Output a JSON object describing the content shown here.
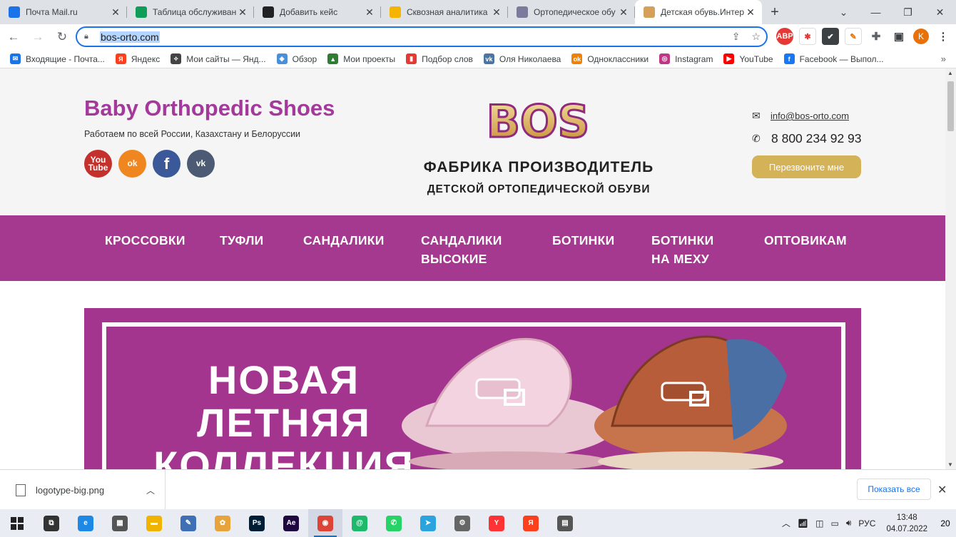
{
  "browser": {
    "tabs": [
      {
        "title": "Почта Mail.ru",
        "icon": "mail-icon",
        "color": "#1a73e8"
      },
      {
        "title": "Таблица обслуживания",
        "icon": "sheets-icon",
        "color": "#0f9d58"
      },
      {
        "title": "Добавить кейс",
        "icon": "star-badge-icon",
        "color": "#202124"
      },
      {
        "title": "Сквозная аналитика",
        "icon": "analytics-icon",
        "color": "#f4b400"
      },
      {
        "title": "Ортопедическое обу",
        "icon": "site-icon",
        "color": "#7b7b9b"
      },
      {
        "title": "Детская обувь.Интер",
        "icon": "bos-favicon-icon",
        "color": "#d4a05a",
        "active": true
      }
    ],
    "new_tab": "+",
    "url": "bos-orto.com",
    "profile_letter": "K"
  },
  "bookmarks": [
    {
      "label": "Входящие - Почта...",
      "color": "#1a73e8",
      "glyph": "✉"
    },
    {
      "label": "Яндекс",
      "color": "#fc3f1d",
      "glyph": "Я"
    },
    {
      "label": "Мои сайты — Янд...",
      "color": "#444",
      "glyph": "⟡"
    },
    {
      "label": "Обзор",
      "color": "#4a90d9",
      "glyph": "◈"
    },
    {
      "label": "Мои проекты",
      "color": "#2e7d32",
      "glyph": "▲"
    },
    {
      "label": "Подбор слов",
      "color": "#e53935",
      "glyph": "▮"
    },
    {
      "label": "Оля Николаева",
      "color": "#4c75a3",
      "glyph": "vk"
    },
    {
      "label": "Одноклассники",
      "color": "#ee8208",
      "glyph": "ok"
    },
    {
      "label": "Instagram",
      "color": "#c13584",
      "glyph": "◎"
    },
    {
      "label": "YouTube",
      "color": "#ff0000",
      "glyph": "▶"
    },
    {
      "label": "Facebook — Выпол...",
      "color": "#1877f2",
      "glyph": "f"
    }
  ],
  "site": {
    "brand": "Baby Orthopedic Shoes",
    "tagline": "Работаем по всей России, Казахстану и Белоруссии",
    "logo_text": "BOS",
    "factory_line1": "ФАБРИКА ПРОИЗВОДИТЕЛЬ",
    "factory_line2": "ДЕТСКОЙ ОРТОПЕДИЧЕСКОЙ ОБУВИ",
    "email": "info@bos-orto.com",
    "phone": "8 800 234 92 93",
    "callback": "Перезвоните мне",
    "socials": [
      {
        "name": "youtube",
        "glyph": "You\nTube",
        "color": "#c4302b"
      },
      {
        "name": "odnoklassniki",
        "glyph": "ok",
        "color": "#f0861f"
      },
      {
        "name": "facebook",
        "glyph": "f",
        "color": "#3b5998"
      },
      {
        "name": "vk",
        "glyph": "vk",
        "color": "#4c5a73"
      }
    ],
    "menu": [
      {
        "label": "КРОССОВКИ"
      },
      {
        "label": "ТУФЛИ"
      },
      {
        "label": "САНДАЛИКИ"
      },
      {
        "label": "САНДАЛИКИ\nВЫСОКИЕ"
      },
      {
        "label": "БОТИНКИ"
      },
      {
        "label": "БОТИНКИ\nНА МЕХУ"
      },
      {
        "label": "ОПТОВИКАМ"
      }
    ],
    "banner_lines": [
      "НОВАЯ",
      "ЛЕТНЯЯ",
      "КОЛЛЕКЦИЯ"
    ],
    "colors": {
      "brand": "#a2399b",
      "menu": "#a5388f",
      "gold": "#d4b257"
    }
  },
  "downloads": {
    "file": "logotype-big.png",
    "show_all": "Показать все"
  },
  "taskbar": {
    "apps": [
      {
        "name": "task-view",
        "color": "#333",
        "glyph": "⧉"
      },
      {
        "name": "edge",
        "color": "#1e88e5",
        "glyph": "e"
      },
      {
        "name": "calculator",
        "color": "#555",
        "glyph": "▦"
      },
      {
        "name": "explorer",
        "color": "#f0b400",
        "glyph": "▬"
      },
      {
        "name": "notes",
        "color": "#3f6fb5",
        "glyph": "✎"
      },
      {
        "name": "paint",
        "color": "#e8a43a",
        "glyph": "✿"
      },
      {
        "name": "photoshop",
        "color": "#001e36",
        "glyph": "Ps"
      },
      {
        "name": "after-effects",
        "color": "#1f0740",
        "glyph": "Ae"
      },
      {
        "name": "chrome",
        "color": "#db4437",
        "glyph": "◉",
        "active": true
      },
      {
        "name": "mail-at",
        "color": "#1eb96b",
        "glyph": "@"
      },
      {
        "name": "whatsapp",
        "color": "#25d366",
        "glyph": "✆"
      },
      {
        "name": "telegram",
        "color": "#2aa3df",
        "glyph": "➤"
      },
      {
        "name": "settings",
        "color": "#666",
        "glyph": "⚙"
      },
      {
        "name": "yandex-browser",
        "color": "#ff3333",
        "glyph": "Y"
      },
      {
        "name": "yandex",
        "color": "#fc3f1d",
        "glyph": "Я"
      },
      {
        "name": "printer-app",
        "color": "#555",
        "glyph": "▤"
      }
    ],
    "lang": "РУС",
    "time": "13:48",
    "date": "04.07.2022",
    "notif_count": "20"
  }
}
